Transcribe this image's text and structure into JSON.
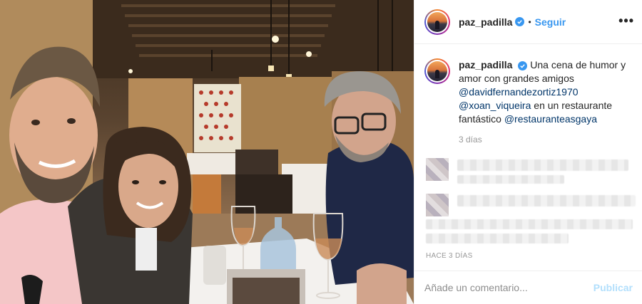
{
  "post": {
    "username": "paz_padilla",
    "separator": "•",
    "follow_label": "Seguir",
    "more_label": "•••",
    "caption": {
      "username": "paz_padilla",
      "text_1": "Una cena de humor y amor con grandes amigos",
      "mention_1": "@davidfernandezortiz1970",
      "mention_2": "@xoan_viqueira",
      "text_2": "en un restaurante fantástico",
      "mention_3": "@restauranteasgaya"
    },
    "caption_age": "3 días",
    "post_date": "HACE 3 DÍAS",
    "comment_placeholder": "Añade un comentario...",
    "publish_label": "Publicar"
  },
  "colors": {
    "accent": "#3897f0",
    "mention": "#003569",
    "publish_disabled": "#b2dffc",
    "muted": "#999999"
  },
  "icons": {
    "verified": "verified-badge-icon",
    "more": "more-options-icon"
  }
}
